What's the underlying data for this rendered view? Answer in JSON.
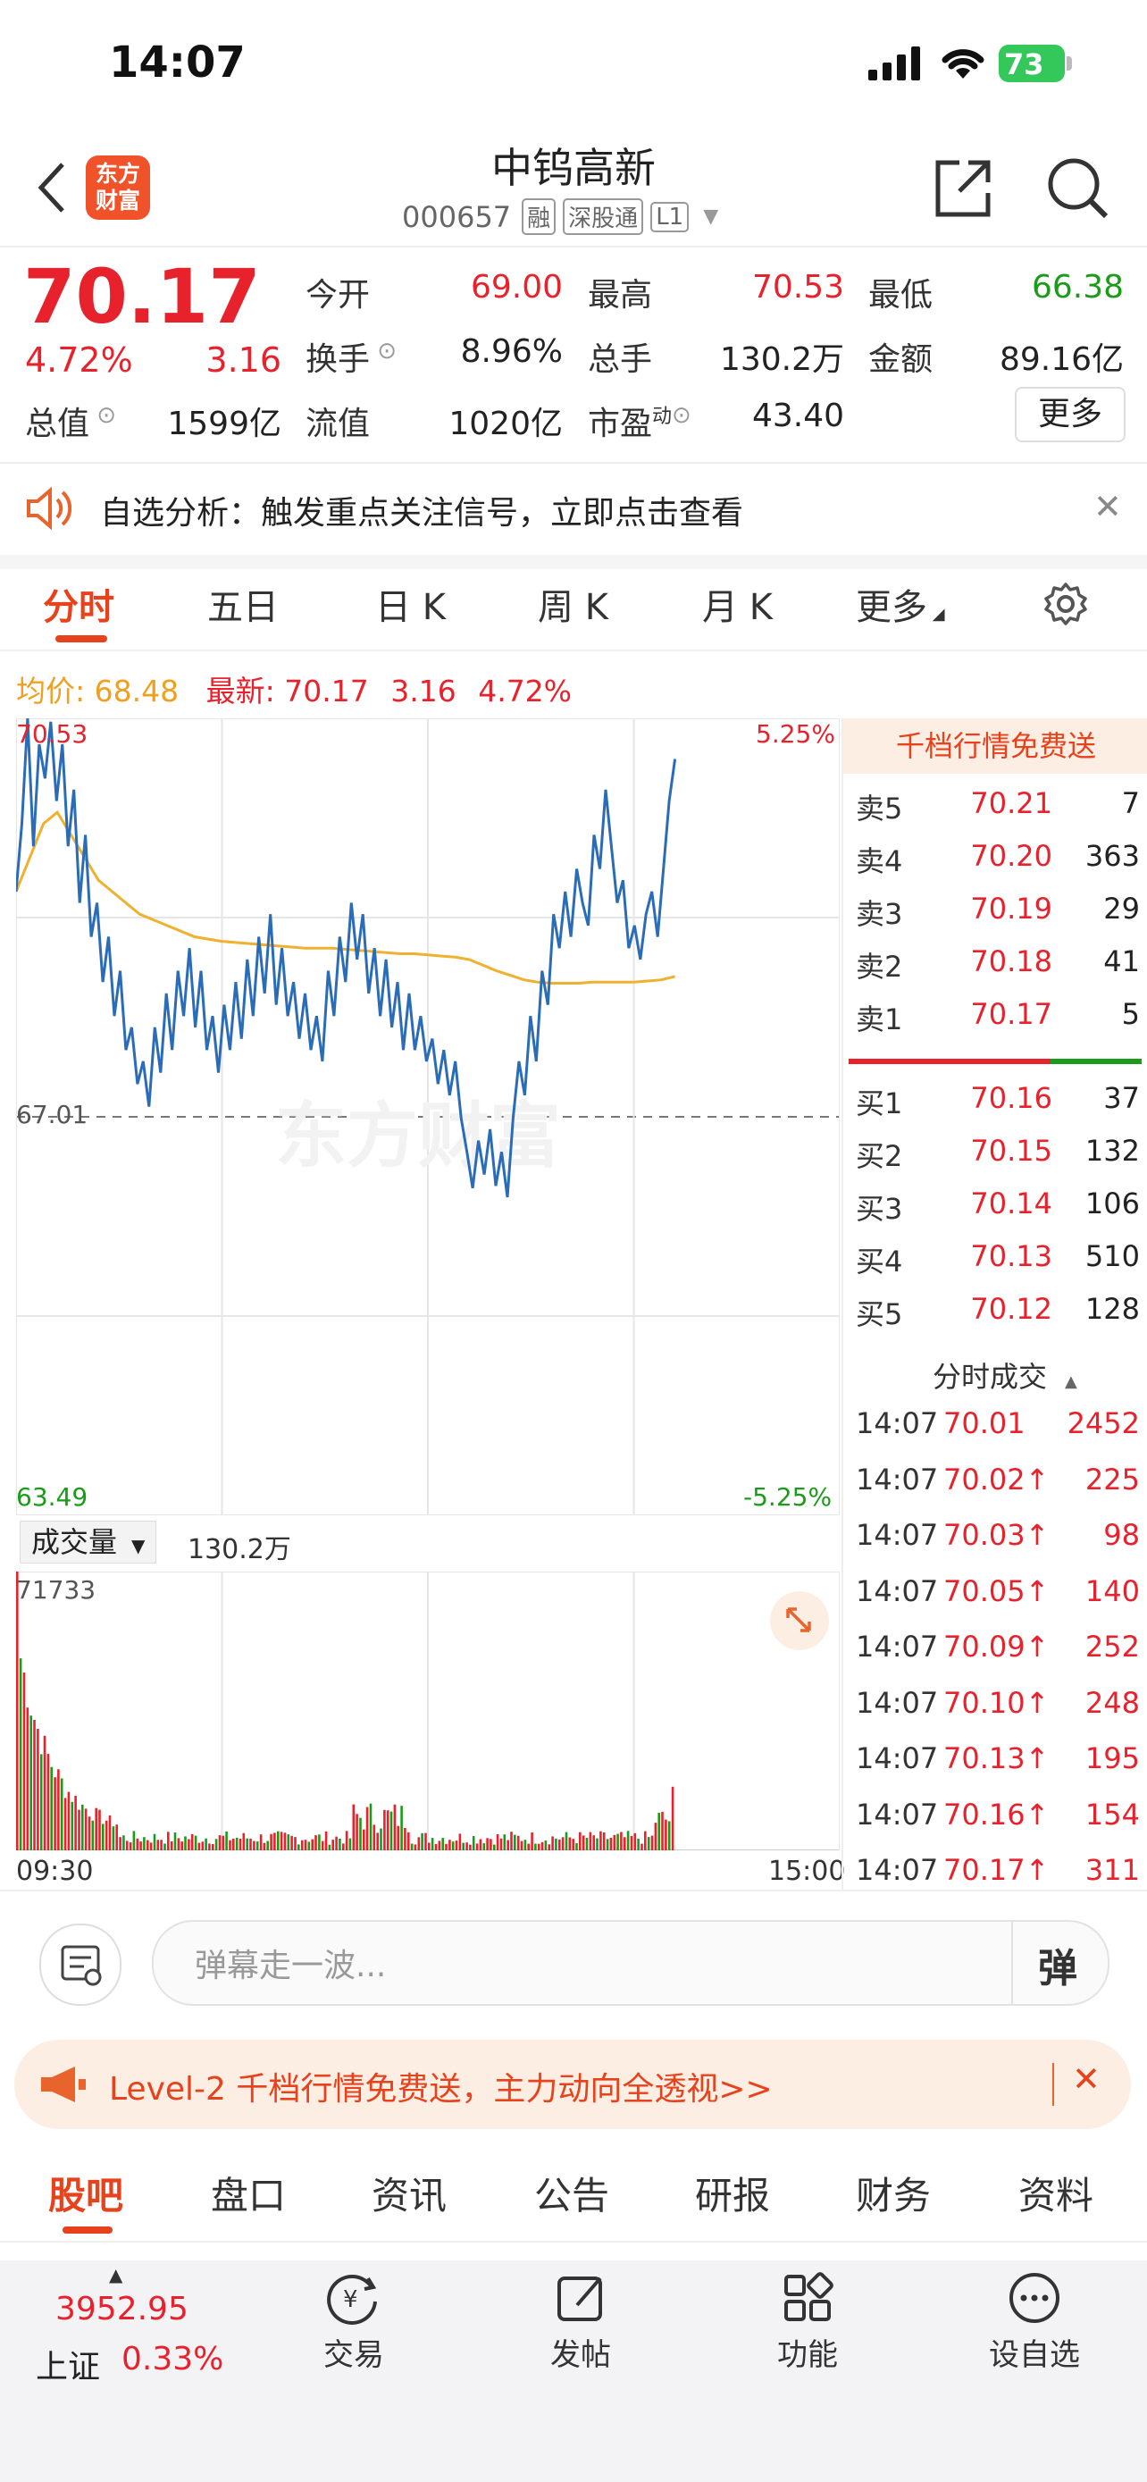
{
  "status": {
    "time": "14:07",
    "battery": "73"
  },
  "header": {
    "logo_line1": "东方",
    "logo_line2": "财富",
    "stock_name": "中钨高新",
    "stock_code": "000657",
    "tags": [
      "融",
      "深股通",
      "L1"
    ]
  },
  "quote": {
    "price": "70.17",
    "change_pct": "4.72%",
    "change": "3.16",
    "open_label": "今开",
    "open": "69.00",
    "high_label": "最高",
    "high": "70.53",
    "low_label": "最低",
    "low": "66.38",
    "turnover_label": "换手",
    "turnover": "8.96%",
    "volume_label": "总手",
    "volume": "130.2万",
    "amount_label": "金额",
    "amount": "89.16亿",
    "mktcap_label": "总值",
    "mktcap": "1599亿",
    "float_label": "流值",
    "float": "1020亿",
    "pe_label": "市盈",
    "pe_sup": "动",
    "pe": "43.40",
    "more_button": "更多"
  },
  "notice": {
    "text": "自选分析：触发重点关注信号，立即点击查看"
  },
  "chart_tabs": [
    "分时",
    "五日",
    "日 K",
    "周 K",
    "月 K",
    "更多"
  ],
  "info_line": {
    "avg_label": "均价:",
    "avg": "68.48",
    "latest_label": "最新:",
    "latest": "70.17",
    "change": "3.16",
    "pct": "4.72%"
  },
  "chart_labels": {
    "high": "70.53",
    "mid": "67.01",
    "low": "63.49",
    "pct_up": "5.25%",
    "pct_down": "-5.25%",
    "watermark": "东方财富",
    "vol_selector": "成交量",
    "vol_total": "130.2万",
    "vol_max": "71733",
    "time_start": "09:30",
    "time_end": "15:00"
  },
  "chart_data": {
    "type": "line",
    "ylim": [
      63.49,
      70.53
    ],
    "prev_close": 67.01,
    "series": [
      {
        "values": [
          69.0,
          69.6,
          70.53,
          69.4,
          70.3,
          70.0,
          70.5,
          69.8,
          70.3,
          69.4,
          69.9,
          68.9,
          69.5,
          68.6,
          68.9,
          68.2,
          68.6,
          67.9,
          68.3,
          67.6,
          67.8,
          67.3,
          67.5,
          67.1,
          67.8,
          67.4,
          68.1,
          67.6,
          68.3,
          67.9,
          68.5,
          67.8,
          68.3,
          67.6,
          67.9,
          67.4,
          68.0,
          67.6,
          68.2,
          67.7,
          68.4,
          67.9,
          68.6,
          68.1,
          68.8,
          68.0,
          68.5,
          67.9,
          68.2,
          67.7,
          68.1,
          67.6,
          67.9,
          67.5,
          68.3,
          67.9,
          68.6,
          68.2,
          68.9,
          68.4,
          68.8,
          68.1,
          68.5,
          67.9,
          68.4,
          67.8,
          68.2,
          67.6,
          68.1,
          67.6,
          67.9,
          67.5,
          67.7,
          67.3,
          67.6,
          67.2,
          67.5,
          67.0,
          66.7,
          66.38,
          66.8,
          66.5,
          66.9,
          66.4,
          66.7,
          66.3,
          67.0,
          67.5,
          67.2,
          67.9,
          67.5,
          68.3,
          68.0,
          68.8,
          68.5,
          69.0,
          68.6,
          69.2,
          68.9,
          68.7,
          69.5,
          69.2,
          69.9,
          69.4,
          68.9,
          69.1,
          68.5,
          68.7,
          68.4,
          68.8,
          69.0,
          68.6,
          69.2,
          69.8,
          70.17
        ]
      },
      {
        "values": [
          69.0,
          69.3,
          69.6,
          69.7,
          69.5,
          69.3,
          69.1,
          69.0,
          68.9,
          68.8,
          68.75,
          68.7,
          68.65,
          68.6,
          68.58,
          68.56,
          68.55,
          68.54,
          68.53,
          68.52,
          68.51,
          68.5,
          68.5,
          68.5,
          68.49,
          68.48,
          68.47,
          68.46,
          68.45,
          68.45,
          68.44,
          68.43,
          68.42,
          68.4,
          68.35,
          68.3,
          68.26,
          68.22,
          68.2,
          68.19,
          68.19,
          68.19,
          68.2,
          68.2,
          68.2,
          68.2,
          68.21,
          68.22,
          68.25
        ]
      }
    ],
    "volume": {
      "max": 71733,
      "total": "130.2万"
    }
  },
  "sidebar": {
    "promo": "千档行情免费送",
    "sell": [
      {
        "label": "卖5",
        "price": "70.21",
        "vol": "7"
      },
      {
        "label": "卖4",
        "price": "70.20",
        "vol": "363"
      },
      {
        "label": "卖3",
        "price": "70.19",
        "vol": "29"
      },
      {
        "label": "卖2",
        "price": "70.18",
        "vol": "41"
      },
      {
        "label": "卖1",
        "price": "70.17",
        "vol": "5"
      }
    ],
    "buy": [
      {
        "label": "买1",
        "price": "70.16",
        "vol": "37"
      },
      {
        "label": "买2",
        "price": "70.15",
        "vol": "132"
      },
      {
        "label": "买3",
        "price": "70.14",
        "vol": "106"
      },
      {
        "label": "买4",
        "price": "70.13",
        "vol": "510"
      },
      {
        "label": "买5",
        "price": "70.12",
        "vol": "128"
      }
    ],
    "trades_title": "分时成交",
    "trades": [
      {
        "time": "14:07",
        "price": "70.01",
        "vol": "2452"
      },
      {
        "time": "14:07",
        "price": "70.02↑",
        "vol": "225"
      },
      {
        "time": "14:07",
        "price": "70.03↑",
        "vol": "98"
      },
      {
        "time": "14:07",
        "price": "70.05↑",
        "vol": "140"
      },
      {
        "time": "14:07",
        "price": "70.09↑",
        "vol": "252"
      },
      {
        "time": "14:07",
        "price": "70.10↑",
        "vol": "248"
      },
      {
        "time": "14:07",
        "price": "70.13↑",
        "vol": "195"
      },
      {
        "time": "14:07",
        "price": "70.16↑",
        "vol": "154"
      },
      {
        "time": "14:07",
        "price": "70.17↑",
        "vol": "311"
      }
    ]
  },
  "comment": {
    "placeholder": "弹幕走一波...",
    "danmu_button": "弹"
  },
  "ad": {
    "text": "Level-2 千档行情免费送，主力动向全透视>>"
  },
  "bottom_tabs": [
    "股吧",
    "盘口",
    "资讯",
    "公告",
    "研报",
    "财务",
    "资料"
  ],
  "tabbar": {
    "index_value": "3952.95",
    "index_name": "上证",
    "index_pct": "0.33%",
    "items": [
      "交易",
      "发帖",
      "功能",
      "设自选"
    ]
  },
  "colors": {
    "red": "#e8222c",
    "green": "#1a9c1a",
    "accent": "#e8421c",
    "blue_line": "#2b6cb8",
    "avg_line": "#f0b030"
  }
}
